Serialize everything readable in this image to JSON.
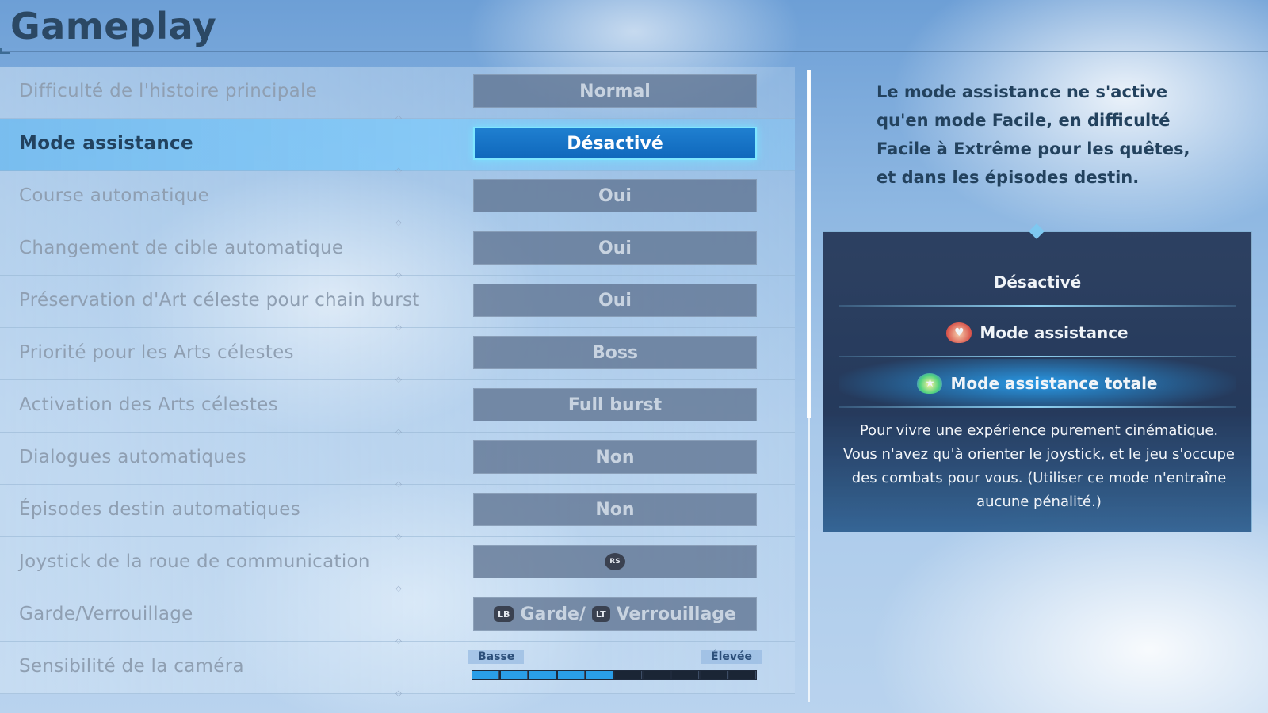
{
  "header": {
    "title": "Gameplay"
  },
  "settings": [
    {
      "label": "Difficulté de l'histoire principale",
      "value": "Normal"
    },
    {
      "label": "Mode assistance",
      "value": "Désactivé",
      "selected": true
    },
    {
      "label": "Course automatique",
      "value": "Oui"
    },
    {
      "label": "Changement de cible automatique",
      "value": "Oui"
    },
    {
      "label": "Préservation d'Art céleste pour chain burst",
      "value": "Oui"
    },
    {
      "label": "Priorité pour les Arts célestes",
      "value": "Boss"
    },
    {
      "label": "Activation des Arts célestes",
      "value": "Full burst"
    },
    {
      "label": "Dialogues automatiques",
      "value": "Non"
    },
    {
      "label": "Épisodes destin automatiques",
      "value": "Non"
    },
    {
      "label": "Joystick de la roue de communication",
      "value_icon": "RS"
    },
    {
      "label": "Garde/Verrouillage",
      "guard_icon": "LB",
      "guard_text": "Garde/",
      "lock_icon": "LT",
      "lock_text": "Verrouillage"
    },
    {
      "label": "Sensibilité de la caméra",
      "slider_low": "Basse",
      "slider_high": "Élevée",
      "slider_segments": 10,
      "slider_level": 5
    }
  ],
  "description": "Le mode assistance ne s'active qu'en mode Facile, en difficulté Facile à Extrême pour les quêtes, et dans les épisodes destin.",
  "options_panel": {
    "options": [
      {
        "label": "Désactivé",
        "icon": ""
      },
      {
        "label": "Mode assistance",
        "icon": "assist-mascot-icon"
      },
      {
        "label": "Mode assistance totale",
        "icon": "total-assist-mascot-icon",
        "highlighted": true
      }
    ],
    "help_text": "Pour vivre une expérience purement cinématique. Vous n'avez qu'à orienter le joystick, et le jeu s'occupe des combats pour vous. (Utiliser ce mode n'entraîne aucune pénalité.)"
  },
  "colors": {
    "selected_value_bg": "#1273c6",
    "selected_value_border": "#7fe6ff",
    "panel_highlight": "#28aaff",
    "slider_fill": "#2a9ee8"
  }
}
